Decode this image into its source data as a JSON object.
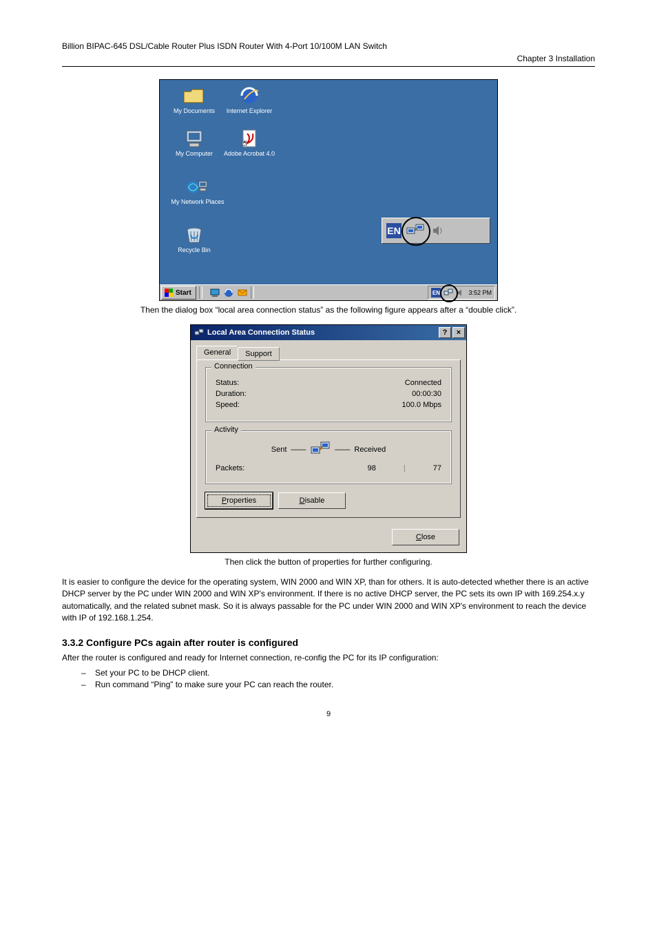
{
  "header": {
    "product": "Billion BIPAC-645 DSL/Cable Router Plus ISDN Router With 4-Port 10/100M LAN Switch",
    "chapter": "Chapter 3 Installation"
  },
  "fig1": {
    "desktop_icons": [
      {
        "label": "My Documents"
      },
      {
        "label": "Internet Explorer"
      },
      {
        "label": "My Computer"
      },
      {
        "label": "Adobe Acrobat 4.0"
      },
      {
        "label": "My Network Places"
      },
      {
        "label": "Recycle Bin"
      }
    ],
    "taskbar": {
      "start": "Start",
      "clock": "3:52 PM"
    },
    "tray_inset": {
      "lang": "EN"
    },
    "caption": "Then the dialog box “local area connection status” as the following figure appears after a “double click”."
  },
  "dialog": {
    "title": "Local Area Connection Status",
    "tabs": {
      "general": "General",
      "support": "Support"
    },
    "connection": {
      "legend": "Connection",
      "status_label": "Status:",
      "status_value": "Connected",
      "duration_label": "Duration:",
      "duration_value": "00:00:30",
      "speed_label": "Speed:",
      "speed_value": "100.0 Mbps"
    },
    "activity": {
      "legend": "Activity",
      "sent_label": "Sent",
      "received_label": "Received",
      "packets_label": "Packets:",
      "packets_sent": "98",
      "packets_received": "77"
    },
    "buttons": {
      "properties": "Properties",
      "disable": "Disable",
      "close": "Close"
    }
  },
  "caption2": "Then click the button of properties for further configuring.",
  "paragraph2": "It is easier to configure the device for the operating system, WIN 2000 and WIN XP, than for others. It is auto-detected whether there is an active DHCP server by the PC under WIN 2000 and WIN XP's environment. If there is no active DHCP server, the PC sets its own IP with 169.254.x.y automatically, and the related subnet mask. So it is always passable for the PC under WIN 2000 and WIN XP's environment to reach the device with IP of 192.168.1.254.",
  "section": {
    "heading": "3.3.2 Configure PCs again after router is configured",
    "intro": "After the router is configured and ready for Internet connection, re-config the PC for its IP configuration:",
    "bullet1": "Set your PC to be DHCP client.",
    "bullet2": "Run command “Ping” to make sure your PC can reach the router."
  },
  "page_number": "9"
}
